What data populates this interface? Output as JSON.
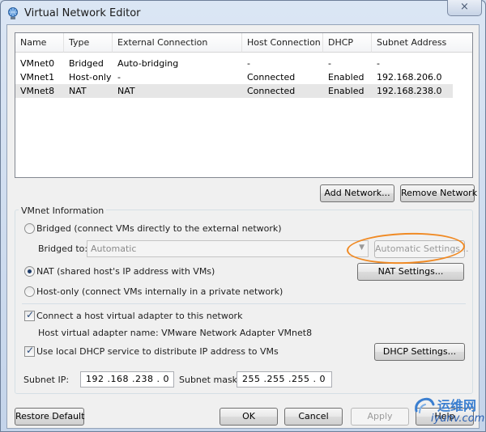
{
  "window": {
    "title": "Virtual Network Editor",
    "close_glyph": "×"
  },
  "table": {
    "columns": [
      "Name",
      "Type",
      "External Connection",
      "Host Connection",
      "DHCP",
      "Subnet Address"
    ],
    "rows": [
      {
        "name": "VMnet0",
        "type": "Bridged",
        "external": "Auto-bridging",
        "host": "-",
        "dhcp": "-",
        "subnet": "-"
      },
      {
        "name": "VMnet1",
        "type": "Host-only",
        "external": "-",
        "host": "Connected",
        "dhcp": "Enabled",
        "subnet": "192.168.206.0"
      },
      {
        "name": "VMnet8",
        "type": "NAT",
        "external": "NAT",
        "host": "Connected",
        "dhcp": "Enabled",
        "subnet": "192.168.238.0"
      }
    ],
    "selected_row": "VMnet8"
  },
  "actions": {
    "add_network": "Add Network...",
    "remove_network": "Remove Network"
  },
  "vmnet_info": {
    "legend": "VMnet Information",
    "bridged_label": "Bridged (connect VMs directly to the external network)",
    "bridged_to_label": "Bridged to:",
    "bridged_to_value": "Automatic",
    "automatic_settings": "Automatic Settings...",
    "nat_label": "NAT (shared host's IP address with VMs)",
    "nat_settings": "NAT Settings...",
    "hostonly_label": "Host-only (connect VMs internally in a private network)",
    "selected_mode": "NAT",
    "connect_adapter_label": "Connect a host virtual adapter to this network",
    "connect_adapter_checked": true,
    "adapter_name_text": "Host virtual adapter name: VMware Network Adapter VMnet8",
    "dhcp_label": "Use local DHCP service to distribute IP address to VMs",
    "dhcp_checked": true,
    "dhcp_settings": "DHCP Settings...",
    "subnet_ip_label": "Subnet IP:",
    "subnet_ip_value": "192 .168 .238 .  0",
    "subnet_mask_label": "Subnet mask:",
    "subnet_mask_value": "255 .255 .255 .  0"
  },
  "footer": {
    "restore_default": "Restore Default",
    "ok": "OK",
    "cancel": "Cancel",
    "apply": "Apply",
    "help": "Help"
  },
  "watermark": {
    "text_cn": "运维网",
    "url": "iyunv.com"
  },
  "colors": {
    "annotation_oval": "#f08a24",
    "selected_row": "#e6e6e6",
    "window_frame": "#cfdcec"
  }
}
